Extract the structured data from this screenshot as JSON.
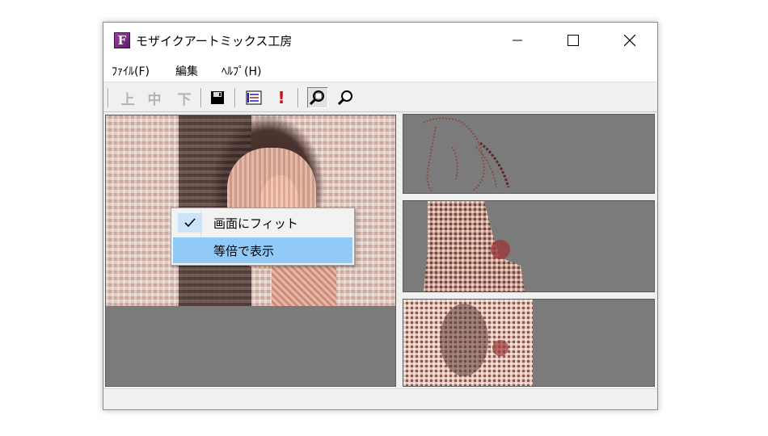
{
  "window": {
    "title": "モザイクアートミックス工房",
    "app_icon_letter": "F"
  },
  "menubar": {
    "items": [
      {
        "label": "ﾌｧｲﾙ(F)"
      },
      {
        "label": "編集"
      },
      {
        "label": "ﾍﾙﾌﾟ(H)"
      }
    ]
  },
  "toolbar": {
    "up_label": "上",
    "middle_label": "中",
    "down_label": "下",
    "exclaim_label": "!"
  },
  "context_menu": {
    "items": [
      {
        "label": "画面にフィット",
        "checked": true
      },
      {
        "label": "等倍で表示",
        "highlighted": true
      }
    ]
  },
  "colors": {
    "pane_gray": "#7b7b7b",
    "highlight": "#91c9f7",
    "check_bg": "#cce4f7"
  }
}
